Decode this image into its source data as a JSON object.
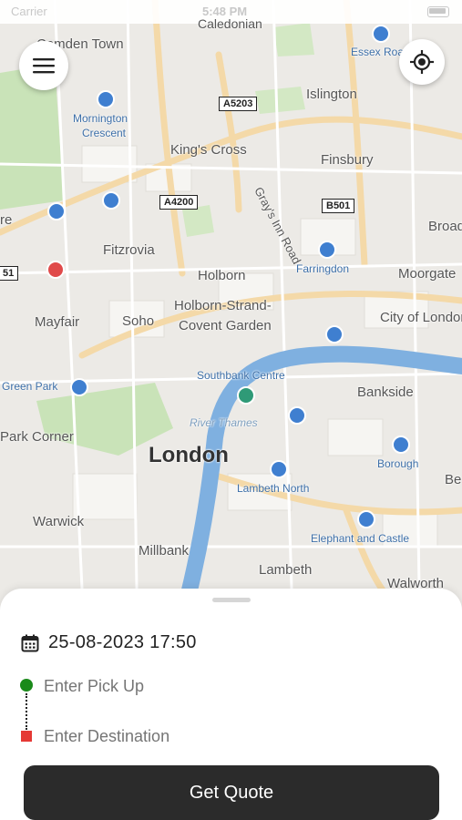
{
  "status_bar": {
    "carrier": "Carrier",
    "time": "5:48 PM"
  },
  "map": {
    "city_label": "London",
    "area_labels": [
      "Camden Town",
      "Islington",
      "King's Cross",
      "Finsbury",
      "Fitzrovia",
      "Holborn",
      "Holborn-Strand-",
      "Covent Garden",
      "Mayfair",
      "Soho",
      "Moorgate",
      "City of London",
      "Bankside",
      "Warwick",
      "Millbank",
      "Lambeth",
      "Walworth",
      "Park Corner",
      "Broad",
      "Be",
      "re"
    ],
    "station_labels": [
      "Mornington",
      "Crescent",
      "Essex Road",
      "Farringdon",
      "Southbank Centre",
      "Green Park",
      "Lambeth North",
      "Borough",
      "Elephant and Castle",
      "Caledonian"
    ],
    "street_labels": [
      "Gray's Inn Road"
    ],
    "river_label": "River Thames",
    "road_shields": [
      "A5203",
      "A4200",
      "B501",
      "51"
    ]
  },
  "icons": {
    "menu": "hamburger-icon",
    "locate": "crosshair-icon",
    "calendar": "calendar-icon"
  },
  "booking": {
    "datetime": "25-08-2023 17:50",
    "pickup_placeholder": "Enter Pick Up",
    "destination_placeholder": "Enter Destination",
    "quote_button": "Get Quote"
  },
  "colors": {
    "button_bg": "#2b2b2b",
    "pickup_marker": "#1a8a1a",
    "destination_marker": "#e53935",
    "river": "#7fb0e0"
  }
}
